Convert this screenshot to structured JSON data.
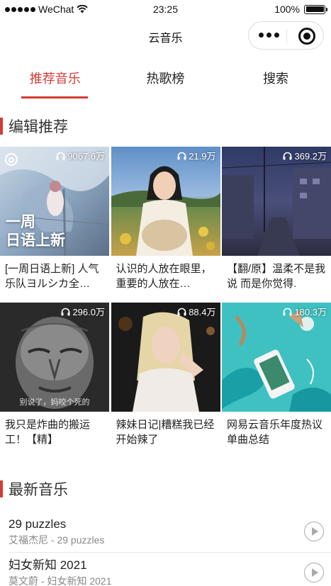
{
  "status_bar": {
    "carrier": "WeChat",
    "time": "23:25",
    "battery": "100%"
  },
  "nav": {
    "title": "云音乐"
  },
  "tabs": [
    {
      "label": "推荐音乐",
      "active": true
    },
    {
      "label": "热歌榜",
      "active": false
    },
    {
      "label": "搜索",
      "active": false
    }
  ],
  "sections": {
    "recommended_title": "编辑推荐",
    "newest_title": "最新音乐"
  },
  "playlists": [
    {
      "playcount": "9067.6万",
      "title": "[一周日语上新] 人气乐队ヨルシカ全…",
      "cover_text": "一周\n日语上新"
    },
    {
      "playcount": "21.9万",
      "title": "认识的人放在眼里，重要的人放在…"
    },
    {
      "playcount": "369.2万",
      "title": "【翻/原】温柔不是我说 而是你觉得."
    },
    {
      "playcount": "296.0万",
      "title": "我只是炸曲的搬运工！【精】",
      "cover_text": "别说了，妈咬个死的"
    },
    {
      "playcount": "88.4万",
      "title": "辣妹日记|糟糕我已经开始辣了"
    },
    {
      "playcount": "180.3万",
      "title": "网易云音乐年度热议单曲总结"
    }
  ],
  "songs": [
    {
      "title": "29 puzzles",
      "subtitle": "艾福杰尼 - 29 puzzles"
    },
    {
      "title": "妇女新知 2021",
      "subtitle": "莫文蔚 - 妇女新知 2021"
    }
  ],
  "colors": {
    "accent": "#d43c33"
  }
}
